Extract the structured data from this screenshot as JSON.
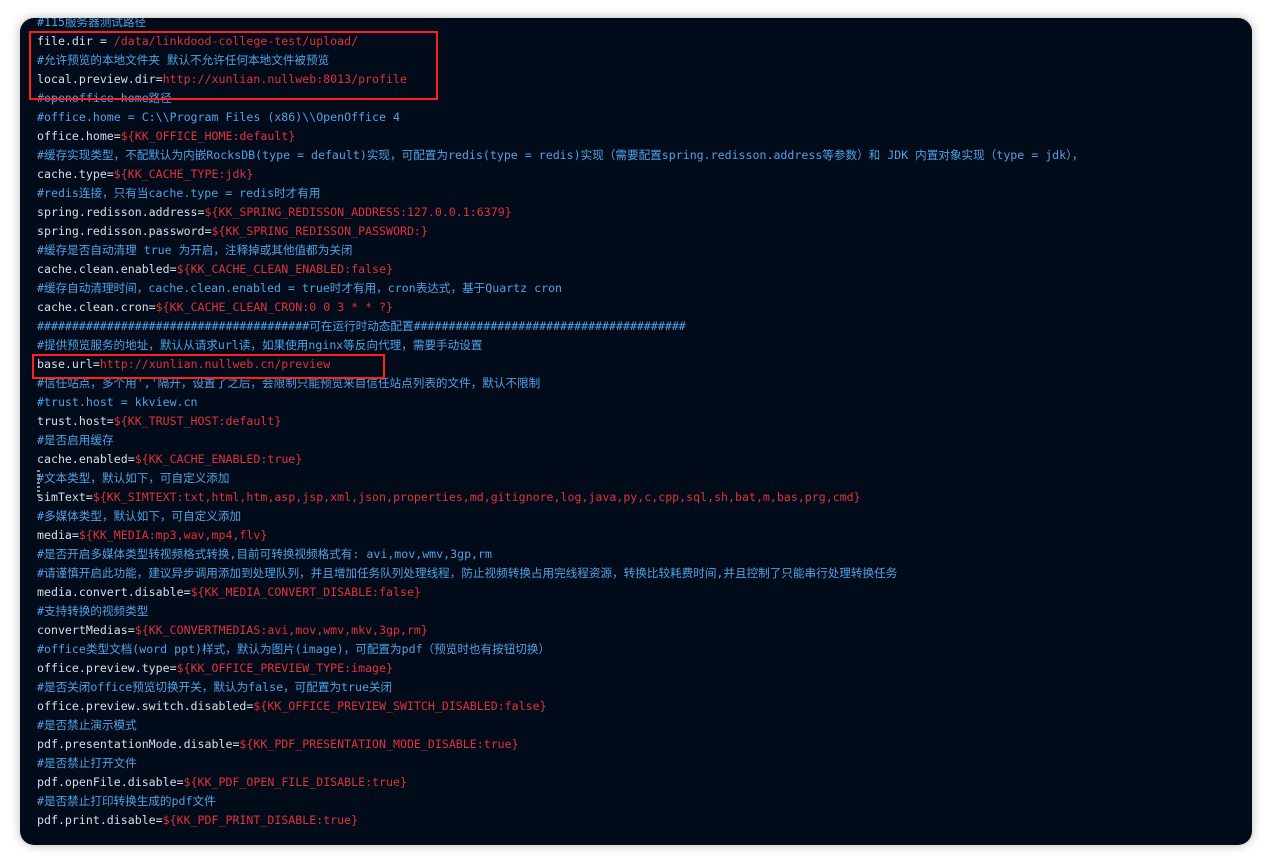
{
  "lines": [
    {
      "type": "comment",
      "text": "#115服务器测试路径"
    },
    {
      "type": "kv",
      "key": "file.dir = ",
      "value": "/data/linkdood-college-test/upload/"
    },
    {
      "type": "comment",
      "text": "#允许预览的本地文件夹 默认不允许任何本地文件被预览"
    },
    {
      "type": "kv",
      "key": "local.preview.dir=",
      "value": "http://xunlian.nullweb:8013/profile"
    },
    {
      "type": "comment",
      "text": "#openoffice home路径"
    },
    {
      "type": "comment",
      "text": "#office.home = C:\\\\Program Files (x86)\\\\OpenOffice 4"
    },
    {
      "type": "kv",
      "key": "office.home=",
      "value": "${KK_OFFICE_HOME:default}"
    },
    {
      "type": "comment",
      "text": "#缓存实现类型，不配默认为内嵌RocksDB(type = default)实现，可配置为redis(type = redis)实现（需要配置spring.redisson.address等参数）和 JDK 内置对象实现（type = jdk），"
    },
    {
      "type": "kv",
      "key": "cache.type=",
      "value": "${KK_CACHE_TYPE:jdk}"
    },
    {
      "type": "comment",
      "text": "#redis连接，只有当cache.type = redis时才有用"
    },
    {
      "type": "kv",
      "key": "spring.redisson.address=",
      "value": "${KK_SPRING_REDISSON_ADDRESS:127.0.0.1:6379}"
    },
    {
      "type": "kv",
      "key": "spring.redisson.password=",
      "value": "${KK_SPRING_REDISSON_PASSWORD:}"
    },
    {
      "type": "comment",
      "text": "#缓存是否自动清理 true 为开启，注释掉或其他值都为关闭"
    },
    {
      "type": "kv",
      "key": "cache.clean.enabled=",
      "value": "${KK_CACHE_CLEAN_ENABLED:false}"
    },
    {
      "type": "comment",
      "text": "#缓存自动清理时间，cache.clean.enabled = true时才有用，cron表达式，基于Quartz cron"
    },
    {
      "type": "kv",
      "key": "cache.clean.cron=",
      "value": "${KK_CACHE_CLEAN_CRON:0 0 3 * * ?}"
    },
    {
      "type": "comment",
      "text": "#######################################可在运行时动态配置#######################################"
    },
    {
      "type": "comment",
      "text": "#提供预览服务的地址，默认从请求url读，如果使用nginx等反向代理，需要手动设置"
    },
    {
      "type": "kv",
      "key": "base.url=",
      "value": "http://xunlian.nullweb.cn/preview"
    },
    {
      "type": "comment",
      "text": "#信任站点，多个用','隔开，设置了之后，会限制只能预览来自信任站点列表的文件，默认不限制"
    },
    {
      "type": "comment",
      "text": "#trust.host = kkview.cn"
    },
    {
      "type": "kv",
      "key": "trust.host=",
      "value": "${KK_TRUST_HOST:default}"
    },
    {
      "type": "comment",
      "text": "#是否启用缓存"
    },
    {
      "type": "kv",
      "key": "cache.enabled=",
      "value": "${KK_CACHE_ENABLED:true}"
    },
    {
      "type": "comment",
      "text": "#文本类型，默认如下，可自定义添加"
    },
    {
      "type": "kv",
      "key": "simText=",
      "value": "${KK_SIMTEXT:txt,html,htm,asp,jsp,xml,json,properties,md,gitignore,log,java,py,c,cpp,sql,sh,bat,m,bas,prg,cmd}"
    },
    {
      "type": "comment",
      "text": "#多媒体类型，默认如下，可自定义添加"
    },
    {
      "type": "kv",
      "key": "media=",
      "value": "${KK_MEDIA:mp3,wav,mp4,flv}"
    },
    {
      "type": "comment",
      "text": "#是否开启多媒体类型转视频格式转换,目前可转换视频格式有: avi,mov,wmv,3gp,rm"
    },
    {
      "type": "comment",
      "text": "#请谨慎开启此功能，建议异步调用添加到处理队列，并且增加任务队列处理线程，防止视频转换占用完线程资源，转换比较耗费时间,并且控制了只能串行处理转换任务"
    },
    {
      "type": "kv",
      "key": "media.convert.disable=",
      "value": "${KK_MEDIA_CONVERT_DISABLE:false}"
    },
    {
      "type": "comment",
      "text": "#支持转换的视频类型"
    },
    {
      "type": "kv",
      "key": "convertMedias=",
      "value": "${KK_CONVERTMEDIAS:avi,mov,wmv,mkv,3gp,rm}"
    },
    {
      "type": "comment",
      "text": "#office类型文档(word ppt)样式，默认为图片(image)，可配置为pdf（预览时也有按钮切换）"
    },
    {
      "type": "kv",
      "key": "office.preview.type=",
      "value": "${KK_OFFICE_PREVIEW_TYPE:image}"
    },
    {
      "type": "comment",
      "text": "#是否关闭office预览切换开关，默认为false，可配置为true关闭"
    },
    {
      "type": "kv",
      "key": "office.preview.switch.disabled=",
      "value": "${KK_OFFICE_PREVIEW_SWITCH_DISABLED:false}"
    },
    {
      "type": "comment",
      "text": "#是否禁止演示模式"
    },
    {
      "type": "kv",
      "key": "pdf.presentationMode.disable=",
      "value": "${KK_PDF_PRESENTATION_MODE_DISABLE:true}"
    },
    {
      "type": "comment",
      "text": "#是否禁止打开文件"
    },
    {
      "type": "kv",
      "key": "pdf.openFile.disable=",
      "value": "${KK_PDF_OPEN_FILE_DISABLE:true}"
    },
    {
      "type": "comment",
      "text": "#是否禁止打印转换生成的pdf文件"
    },
    {
      "type": "kv",
      "key": "pdf.print.disable=",
      "value": "${KK_PDF_PRINT_DISABLE:true}"
    }
  ],
  "colors": {
    "background": "#020b19",
    "comment": "#4fa2e6",
    "key": "#d7dee8",
    "value": "#e0323b",
    "highlight_box": "#ff1f1f"
  }
}
